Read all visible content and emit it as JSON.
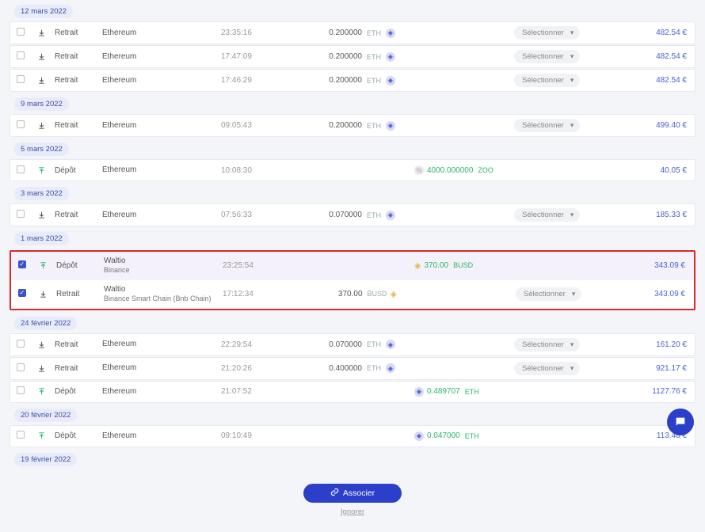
{
  "actions": {
    "associate": "Associer",
    "ignore": "Ignorer",
    "select_placeholder": "Sélectionner"
  },
  "types": {
    "withdraw": "Retrait",
    "deposit": "Dépôt"
  },
  "sources": {
    "ethereum": "Ethereum",
    "waltio": "Waltio",
    "binance": "Binance",
    "bnbchain": "Binance Smart Chain (Bnb Chain)"
  },
  "groups": [
    {
      "date": "12 mars 2022",
      "rows": [
        {
          "checked": false,
          "dir": "out",
          "type_key": "withdraw",
          "source": [
            "ethereum"
          ],
          "time": "23:35:16",
          "amount_out": "0.200000",
          "ticker_out": "ETH",
          "out_icon": "eth",
          "eur": "482.54 €",
          "select": true
        },
        {
          "checked": false,
          "dir": "out",
          "type_key": "withdraw",
          "source": [
            "ethereum"
          ],
          "time": "17:47:09",
          "amount_out": "0.200000",
          "ticker_out": "ETH",
          "out_icon": "eth",
          "eur": "482.54 €",
          "select": true
        },
        {
          "checked": false,
          "dir": "out",
          "type_key": "withdraw",
          "source": [
            "ethereum"
          ],
          "time": "17:46:29",
          "amount_out": "0.200000",
          "ticker_out": "ETH",
          "out_icon": "eth",
          "eur": "482.54 €",
          "select": true
        }
      ]
    },
    {
      "date": "9 mars 2022",
      "rows": [
        {
          "checked": false,
          "dir": "out",
          "type_key": "withdraw",
          "source": [
            "ethereum"
          ],
          "time": "09:05:43",
          "amount_out": "0.200000",
          "ticker_out": "ETH",
          "out_icon": "eth",
          "eur": "499.40 €",
          "select": true
        }
      ]
    },
    {
      "date": "5 mars 2022",
      "rows": [
        {
          "checked": false,
          "dir": "in",
          "type_key": "deposit",
          "source": [
            "ethereum"
          ],
          "time": "10:08:30",
          "amount_in": "4000.000000",
          "ticker_in": "ZOO",
          "in_icon": "zoo",
          "in_green": true,
          "eur": "40.05 €",
          "select": false
        }
      ]
    },
    {
      "date": "3 mars 2022",
      "rows": [
        {
          "checked": false,
          "dir": "out",
          "type_key": "withdraw",
          "source": [
            "ethereum"
          ],
          "time": "07:56:33",
          "amount_out": "0.070000",
          "ticker_out": "ETH",
          "out_icon": "eth",
          "eur": "185.33 €",
          "select": true
        }
      ]
    },
    {
      "date": "1 mars 2022",
      "highlighted": true,
      "rows": [
        {
          "checked": true,
          "dir": "in",
          "type_key": "deposit",
          "source": [
            "waltio",
            "binance"
          ],
          "time": "23:25:54",
          "amount_in": "370.00",
          "ticker_in": "BUSD",
          "in_icon": "busd",
          "in_green": true,
          "eur": "343.09 €",
          "select": false
        },
        {
          "checked": true,
          "dir": "out",
          "type_key": "withdraw",
          "source": [
            "waltio",
            "bnbchain"
          ],
          "time": "17:12:34",
          "amount_out": "370.00",
          "ticker_out": "BUSD",
          "out_icon": "busd",
          "eur": "343.09 €",
          "select": true
        }
      ]
    },
    {
      "date": "24 février 2022",
      "rows": [
        {
          "checked": false,
          "dir": "out",
          "type_key": "withdraw",
          "source": [
            "ethereum"
          ],
          "time": "22:29:54",
          "amount_out": "0.070000",
          "ticker_out": "ETH",
          "out_icon": "eth",
          "eur": "161.20 €",
          "select": true
        },
        {
          "checked": false,
          "dir": "out",
          "type_key": "withdraw",
          "source": [
            "ethereum"
          ],
          "time": "21:20:26",
          "amount_out": "0.400000",
          "ticker_out": "ETH",
          "out_icon": "eth",
          "eur": "921.17 €",
          "select": true
        },
        {
          "checked": false,
          "dir": "in",
          "type_key": "deposit",
          "source": [
            "ethereum"
          ],
          "time": "21:07:52",
          "amount_in": "0.489707",
          "ticker_in": "ETH",
          "in_icon": "eth",
          "in_green": true,
          "eur": "1127.76 €",
          "select": false
        }
      ]
    },
    {
      "date": "20 février 2022",
      "rows": [
        {
          "checked": false,
          "dir": "in",
          "type_key": "deposit",
          "source": [
            "ethereum"
          ],
          "time": "09:10:49",
          "amount_in": "0.047000",
          "ticker_in": "ETH",
          "in_icon": "eth",
          "in_green": true,
          "eur": "113.48 €",
          "select": false
        }
      ]
    },
    {
      "date": "19 février 2022",
      "rows": []
    }
  ]
}
